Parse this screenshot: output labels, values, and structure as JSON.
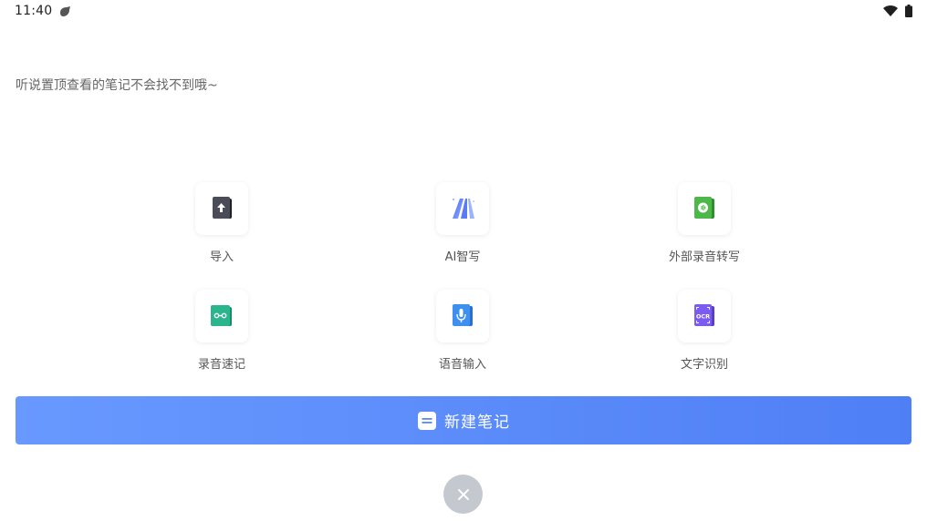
{
  "status_bar": {
    "time": "11:40",
    "app_icon": "notification-app-icon",
    "wifi_icon": "wifi-icon",
    "battery_icon": "battery-icon"
  },
  "hint": {
    "text": "听说置顶查看的笔记不会找不到哦~"
  },
  "actions": [
    {
      "label": "导入",
      "icon": "import-icon",
      "color": "#3a3d45"
    },
    {
      "label": "AI智写",
      "icon": "ai-write-icon",
      "color": "#5b7bf5"
    },
    {
      "label": "外部录音转写",
      "icon": "audio-transcribe-icon",
      "color": "#4cb84a"
    },
    {
      "label": "录音速记",
      "icon": "voice-memo-icon",
      "color": "#2bb58c"
    },
    {
      "label": "语音输入",
      "icon": "voice-input-icon",
      "color": "#3d8ff0"
    },
    {
      "label": "文字识别",
      "icon": "ocr-icon",
      "color": "#7c5cf0"
    }
  ],
  "new_note_button": {
    "label": "新建笔记",
    "icon": "note-icon",
    "gradient_start": "#6899ff",
    "gradient_end": "#4f7ff5"
  },
  "close_button": {
    "icon": "close-icon",
    "color": "#c4c8cf"
  }
}
